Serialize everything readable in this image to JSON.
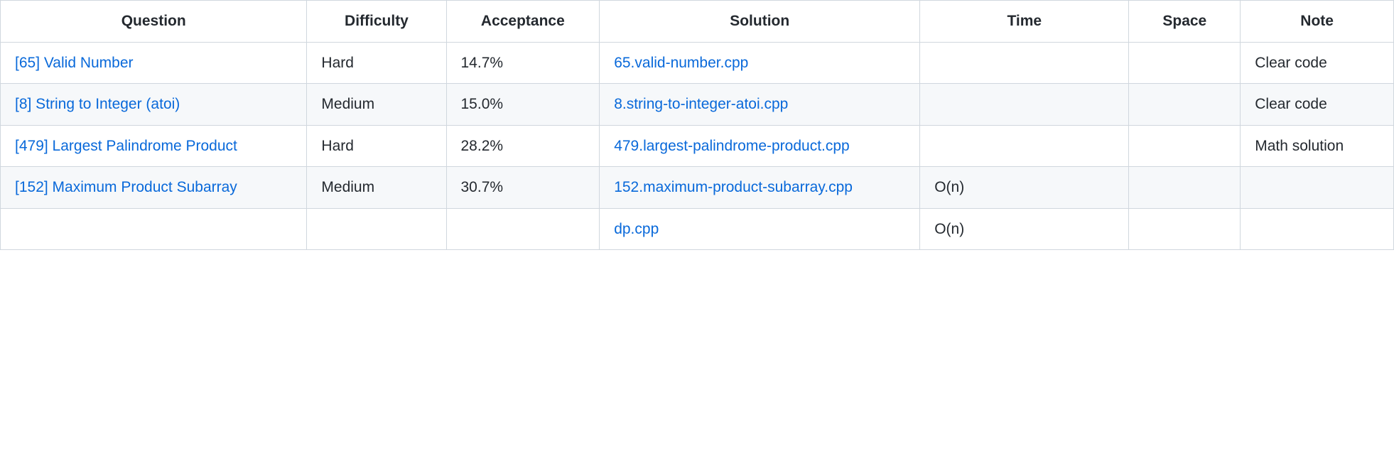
{
  "table": {
    "headers": {
      "question": "Question",
      "difficulty": "Difficulty",
      "acceptance": "Acceptance",
      "solution": "Solution",
      "time": "Time",
      "space": "Space",
      "note": "Note"
    },
    "rows": [
      {
        "question": "[65] Valid Number",
        "difficulty": "Hard",
        "acceptance": "14.7%",
        "solution": "65.valid-number.cpp",
        "time": "",
        "space": "",
        "note": "Clear code"
      },
      {
        "question": "[8] String to Integer (atoi)",
        "difficulty": "Medium",
        "acceptance": "15.0%",
        "solution": "8.string-to-integer-atoi.cpp",
        "time": "",
        "space": "",
        "note": "Clear code"
      },
      {
        "question": "[479] Largest Palindrome Product",
        "difficulty": "Hard",
        "acceptance": "28.2%",
        "solution": "479.largest-palindrome-product.cpp",
        "time": "",
        "space": "",
        "note": "Math solution"
      },
      {
        "question": "[152] Maximum Product Subarray",
        "difficulty": "Medium",
        "acceptance": "30.7%",
        "solution": "152.maximum-product-subarray.cpp",
        "time": "O(n)",
        "space": "",
        "note": ""
      },
      {
        "question": "",
        "difficulty": "",
        "acceptance": "",
        "solution": "dp.cpp",
        "time": "O(n)",
        "space": "",
        "note": ""
      }
    ]
  }
}
